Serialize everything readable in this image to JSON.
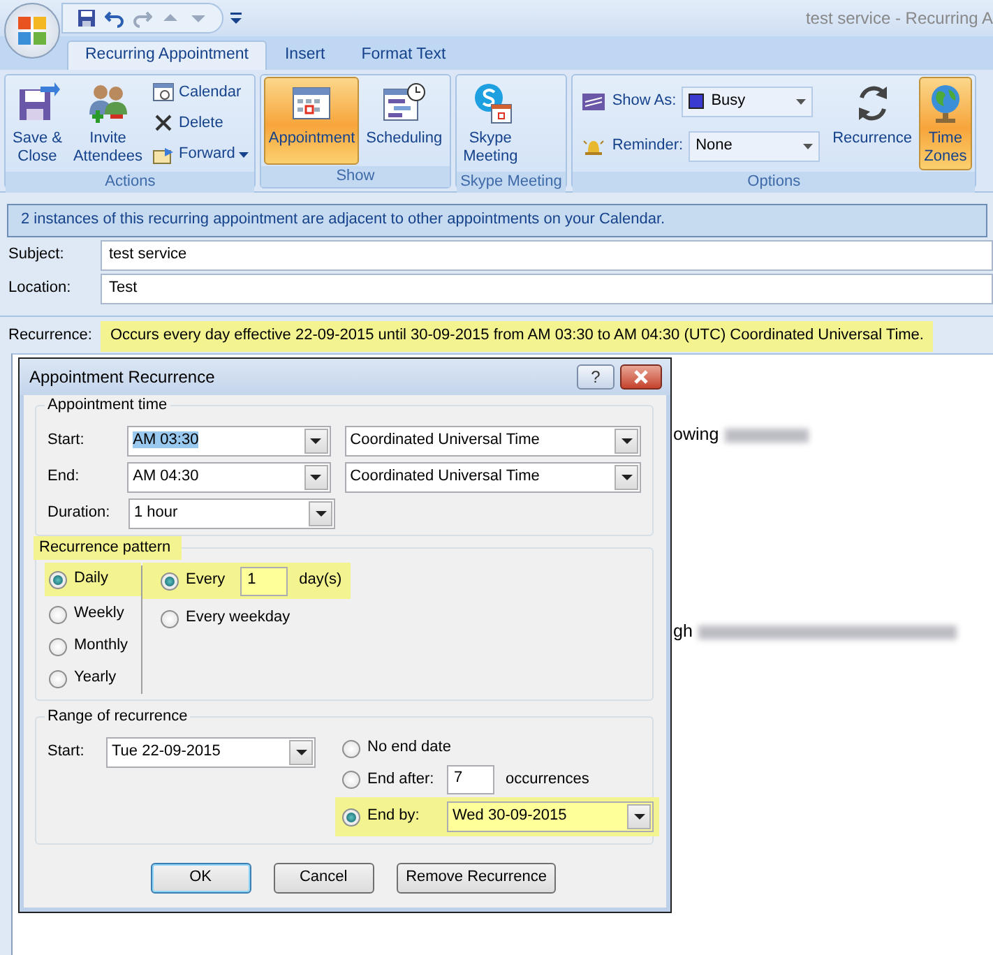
{
  "window": {
    "title": "test service - Recurring A"
  },
  "tabs": [
    {
      "label": "Recurring Appointment",
      "selected": true
    },
    {
      "label": "Insert",
      "selected": false
    },
    {
      "label": "Format Text",
      "selected": false
    }
  ],
  "ribbon_groups": [
    {
      "label": "Actions",
      "items": [
        {
          "kind": "large",
          "lines": [
            "Save &",
            "Close"
          ],
          "selected": false
        },
        {
          "kind": "large",
          "lines": [
            "Invite",
            "Attendees"
          ],
          "selected": false
        },
        {
          "kind": "small",
          "label": "Calendar"
        },
        {
          "kind": "small",
          "label": "Delete"
        },
        {
          "kind": "small",
          "label": "Forward",
          "has_menu": true
        }
      ]
    },
    {
      "label": "Show",
      "items": [
        {
          "kind": "large",
          "lines": [
            "Appointment"
          ],
          "selected": true
        },
        {
          "kind": "large",
          "lines": [
            "Scheduling"
          ],
          "selected": false
        }
      ]
    },
    {
      "label": "Skype Meeting",
      "items": [
        {
          "kind": "large",
          "lines": [
            "Skype",
            "Meeting"
          ],
          "selected": false
        }
      ]
    },
    {
      "label": "Options",
      "items": [
        {
          "kind": "fields",
          "fields": [
            {
              "label": "Show As:",
              "value": "Busy",
              "color": "#3a3ad0"
            },
            {
              "label": "Reminder:",
              "value": "None"
            }
          ]
        },
        {
          "kind": "large",
          "lines": [
            "Recurrence"
          ],
          "selected": false
        },
        {
          "kind": "large",
          "lines": [
            "Time",
            "Zones"
          ],
          "selected": true
        }
      ]
    }
  ],
  "info_bar": "2 instances of this recurring appointment are adjacent to other appointments on your Calendar.",
  "form": [
    {
      "label": "Subject:",
      "value": "test service"
    },
    {
      "label": "Location:",
      "value": "Test"
    }
  ],
  "recurrence": {
    "label": "Recurrence:",
    "value": "Occurs every day effective 22-09-2015 until 30-09-2015 from AM 03:30 to AM 04:30 (UTC) Coordinated Universal Time.",
    "highlighted": true
  },
  "body_lines": [
    {
      "text": "owing"
    },
    {
      "text": "gh"
    }
  ],
  "dialog": {
    "title": "Appointment Recurrence",
    "help": "?",
    "appointment_time": {
      "label": "Appointment time",
      "rows": [
        {
          "label": "Start:",
          "value": "AM 03:30",
          "text_selected": true,
          "zone": "Coordinated Universal Time"
        },
        {
          "label": "End:",
          "value": "AM 04:30",
          "text_selected": false,
          "zone": "Coordinated Universal Time"
        },
        {
          "label": "Duration:",
          "value": "1 hour",
          "text_selected": false
        }
      ]
    },
    "recurrence_pattern": {
      "label": "Recurrence pattern",
      "highlighted": true,
      "patterns": [
        {
          "label": "Daily",
          "selected": true
        },
        {
          "label": "Weekly",
          "selected": false
        },
        {
          "label": "Monthly",
          "selected": false
        },
        {
          "label": "Yearly",
          "selected": false
        }
      ],
      "options": [
        {
          "kind": "every",
          "label": "Every",
          "value": "1",
          "unit": "day(s)",
          "selected": true
        },
        {
          "kind": "weekday",
          "label": "Every weekday",
          "selected": false
        }
      ]
    },
    "range": {
      "label": "Range of recurrence",
      "start_label": "Start:",
      "start_value": "Tue 22-09-2015",
      "ends": [
        {
          "kind": "none",
          "label": "No end date",
          "selected": false,
          "highlighted": false
        },
        {
          "kind": "after",
          "label": "End after:",
          "value": "7",
          "unit": "occurrences",
          "selected": false,
          "highlighted": false
        },
        {
          "kind": "by",
          "label": "End by:",
          "value": "Wed 30-09-2015",
          "selected": true,
          "highlighted": true
        }
      ]
    },
    "buttons": [
      {
        "label": "OK",
        "default": true
      },
      {
        "label": "Cancel",
        "default": false
      },
      {
        "label": "Remove Recurrence",
        "default": false
      }
    ]
  }
}
